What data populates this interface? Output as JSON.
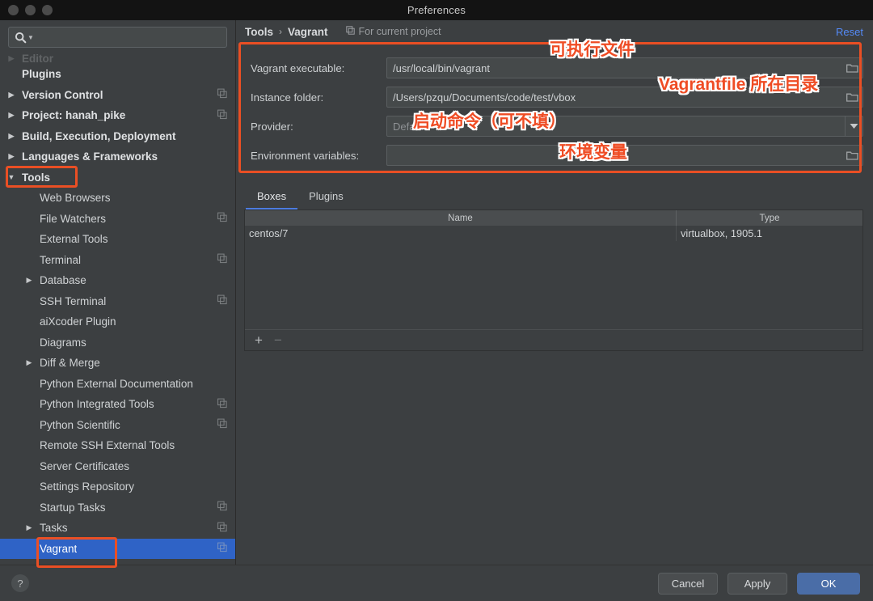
{
  "window": {
    "title": "Preferences"
  },
  "sidebar": {
    "search_placeholder": "",
    "search_value": "",
    "items": [
      {
        "label": "Editor",
        "level": 0,
        "arrow": "right",
        "bold": true,
        "faded": true,
        "copy": false,
        "selected": false
      },
      {
        "label": "Plugins",
        "level": 0,
        "arrow": "none",
        "bold": true,
        "faded": false,
        "copy": false,
        "selected": false
      },
      {
        "label": "Version Control",
        "level": 0,
        "arrow": "right",
        "bold": true,
        "faded": false,
        "copy": true,
        "selected": false
      },
      {
        "label": "Project: hanah_pike",
        "level": 0,
        "arrow": "right",
        "bold": true,
        "faded": false,
        "copy": true,
        "selected": false
      },
      {
        "label": "Build, Execution, Deployment",
        "level": 0,
        "arrow": "right",
        "bold": true,
        "faded": false,
        "copy": false,
        "selected": false
      },
      {
        "label": "Languages & Frameworks",
        "level": 0,
        "arrow": "right",
        "bold": true,
        "faded": false,
        "copy": false,
        "selected": false
      },
      {
        "label": "Tools",
        "level": 0,
        "arrow": "down",
        "bold": true,
        "faded": false,
        "copy": false,
        "selected": false
      },
      {
        "label": "Web Browsers",
        "level": 1,
        "arrow": "none",
        "bold": false,
        "faded": false,
        "copy": false,
        "selected": false
      },
      {
        "label": "File Watchers",
        "level": 1,
        "arrow": "none",
        "bold": false,
        "faded": false,
        "copy": true,
        "selected": false
      },
      {
        "label": "External Tools",
        "level": 1,
        "arrow": "none",
        "bold": false,
        "faded": false,
        "copy": false,
        "selected": false
      },
      {
        "label": "Terminal",
        "level": 1,
        "arrow": "none",
        "bold": false,
        "faded": false,
        "copy": true,
        "selected": false
      },
      {
        "label": "Database",
        "level": 1,
        "arrow": "right",
        "bold": false,
        "faded": false,
        "copy": false,
        "selected": false
      },
      {
        "label": "SSH Terminal",
        "level": 1,
        "arrow": "none",
        "bold": false,
        "faded": false,
        "copy": true,
        "selected": false
      },
      {
        "label": "aiXcoder Plugin",
        "level": 1,
        "arrow": "none",
        "bold": false,
        "faded": false,
        "copy": false,
        "selected": false
      },
      {
        "label": "Diagrams",
        "level": 1,
        "arrow": "none",
        "bold": false,
        "faded": false,
        "copy": false,
        "selected": false
      },
      {
        "label": "Diff & Merge",
        "level": 1,
        "arrow": "right",
        "bold": false,
        "faded": false,
        "copy": false,
        "selected": false
      },
      {
        "label": "Python External Documentation",
        "level": 1,
        "arrow": "none",
        "bold": false,
        "faded": false,
        "copy": false,
        "selected": false
      },
      {
        "label": "Python Integrated Tools",
        "level": 1,
        "arrow": "none",
        "bold": false,
        "faded": false,
        "copy": true,
        "selected": false
      },
      {
        "label": "Python Scientific",
        "level": 1,
        "arrow": "none",
        "bold": false,
        "faded": false,
        "copy": true,
        "selected": false
      },
      {
        "label": "Remote SSH External Tools",
        "level": 1,
        "arrow": "none",
        "bold": false,
        "faded": false,
        "copy": false,
        "selected": false
      },
      {
        "label": "Server Certificates",
        "level": 1,
        "arrow": "none",
        "bold": false,
        "faded": false,
        "copy": false,
        "selected": false
      },
      {
        "label": "Settings Repository",
        "level": 1,
        "arrow": "none",
        "bold": false,
        "faded": false,
        "copy": false,
        "selected": false
      },
      {
        "label": "Startup Tasks",
        "level": 1,
        "arrow": "none",
        "bold": false,
        "faded": false,
        "copy": true,
        "selected": false
      },
      {
        "label": "Tasks",
        "level": 1,
        "arrow": "right",
        "bold": false,
        "faded": false,
        "copy": true,
        "selected": false
      },
      {
        "label": "Vagrant",
        "level": 1,
        "arrow": "none",
        "bold": false,
        "faded": false,
        "copy": true,
        "selected": true
      }
    ]
  },
  "header": {
    "breadcrumb_root": "Tools",
    "breadcrumb_sep": "›",
    "breadcrumb_leaf": "Vagrant",
    "scope_note": "For current project",
    "reset_label": "Reset"
  },
  "form": {
    "rows": [
      {
        "label": "Vagrant executable:",
        "value": "/usr/local/bin/vagrant",
        "placeholder": "",
        "control": "file"
      },
      {
        "label": "Instance folder:",
        "value": "/Users/pzqu/Documents/code/test/vbox",
        "placeholder": "",
        "control": "file"
      },
      {
        "label": "Provider:",
        "value": "",
        "placeholder": "Default",
        "control": "combo"
      },
      {
        "label": "Environment variables:",
        "value": "",
        "placeholder": "",
        "control": "file"
      }
    ]
  },
  "tabs": {
    "items": [
      {
        "label": "Boxes",
        "active": true
      },
      {
        "label": "Plugins",
        "active": false
      }
    ]
  },
  "table": {
    "columns": [
      "Name",
      "Type"
    ],
    "rows": [
      {
        "name": "centos/7",
        "type": "virtualbox, 1905.1"
      }
    ],
    "toolbar": {
      "add": "+",
      "remove": "−"
    }
  },
  "footer": {
    "help": "?",
    "cancel": "Cancel",
    "apply": "Apply",
    "ok": "OK"
  },
  "annotations": {
    "executable_label": "可执行文件",
    "vagrantfile_label": "Vagrantfile 所在目录",
    "provider_label": "启动命令（可不填）",
    "env_label": "环境变量"
  },
  "colors": {
    "accent": "#4a6da7",
    "selection": "#2f63c6",
    "annotation": "#ea4f24",
    "link": "#548af7",
    "background": "#3c3f41"
  }
}
